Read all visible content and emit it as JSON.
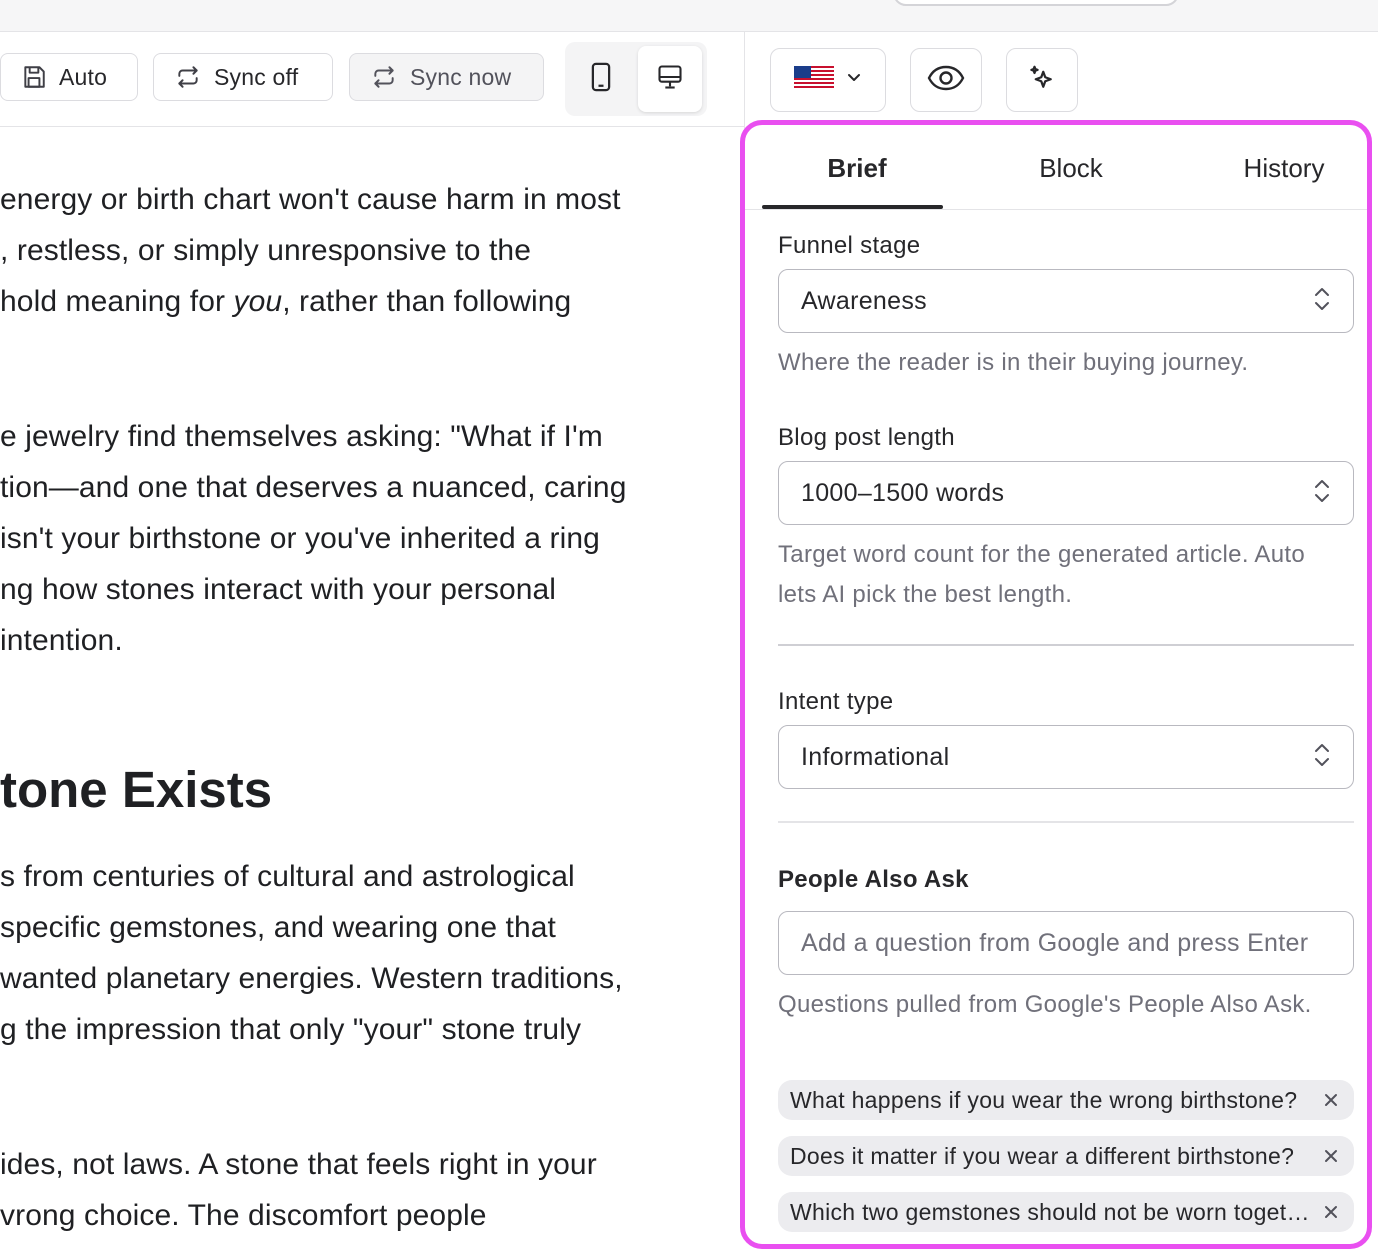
{
  "toolbar": {
    "auto_label": "Auto",
    "sync_off_label": "Sync off",
    "sync_now_label": "Sync now"
  },
  "article": {
    "lines": [
      {
        "before": "energy or birth chart won't cause harm in most",
        "em": "",
        "after": ""
      },
      {
        "before": ", restless, or simply unresponsive to the",
        "em": "",
        "after": ""
      },
      {
        "before": " hold meaning for ",
        "em": "you",
        "after": ", rather than following"
      },
      {
        "before": "e jewelry find themselves asking: \"What if I'm",
        "em": "",
        "after": ""
      },
      {
        "before": "tion—and one that deserves a nuanced, caring",
        "em": "",
        "after": ""
      },
      {
        "before": "isn't your birthstone or you've inherited a ring",
        "em": "",
        "after": ""
      },
      {
        "before": "ng how stones interact with your personal",
        "em": "",
        "after": ""
      },
      {
        "before": " intention.",
        "em": "",
        "after": ""
      }
    ],
    "heading": "tone Exists",
    "lines2": [
      "s from centuries of cultural and astrological",
      " specific gemstones, and wearing one that",
      "wanted planetary energies. Western traditions,",
      "g the impression that only \"your\" stone truly"
    ],
    "lines3": [
      "ides, not laws. A stone that feels right in your",
      "vrong choice. The discomfort people"
    ]
  },
  "panel": {
    "tabs": [
      {
        "label": "Brief",
        "active": true
      },
      {
        "label": "Block",
        "active": false
      },
      {
        "label": "History",
        "active": false
      }
    ],
    "funnel_stage": {
      "label": "Funnel stage",
      "value": "Awareness",
      "help": "Where the reader is in their buying journey."
    },
    "blog_length": {
      "label": "Blog post length",
      "value": "1000–1500 words",
      "help": "Target word count for the generated article. Auto lets AI pick the best length."
    },
    "intent_type": {
      "label": "Intent type",
      "value": "Informational"
    },
    "paa": {
      "label": "People Also Ask",
      "placeholder": "Add a question from Google and press Enter",
      "help": "Questions pulled from Google's People Also Ask.",
      "chips": [
        "What happens if you wear the wrong birthstone?",
        "Does it matter if you wear a different birthstone?",
        "Which two gemstones should not be worn together?"
      ]
    }
  },
  "icons": {
    "language": "us-flag-icon",
    "preview": "eye-icon",
    "ai": "sparkles-icon"
  },
  "colors": {
    "panel_border": "#e94ff0",
    "text": "#1f2023",
    "muted": "#70707a"
  }
}
